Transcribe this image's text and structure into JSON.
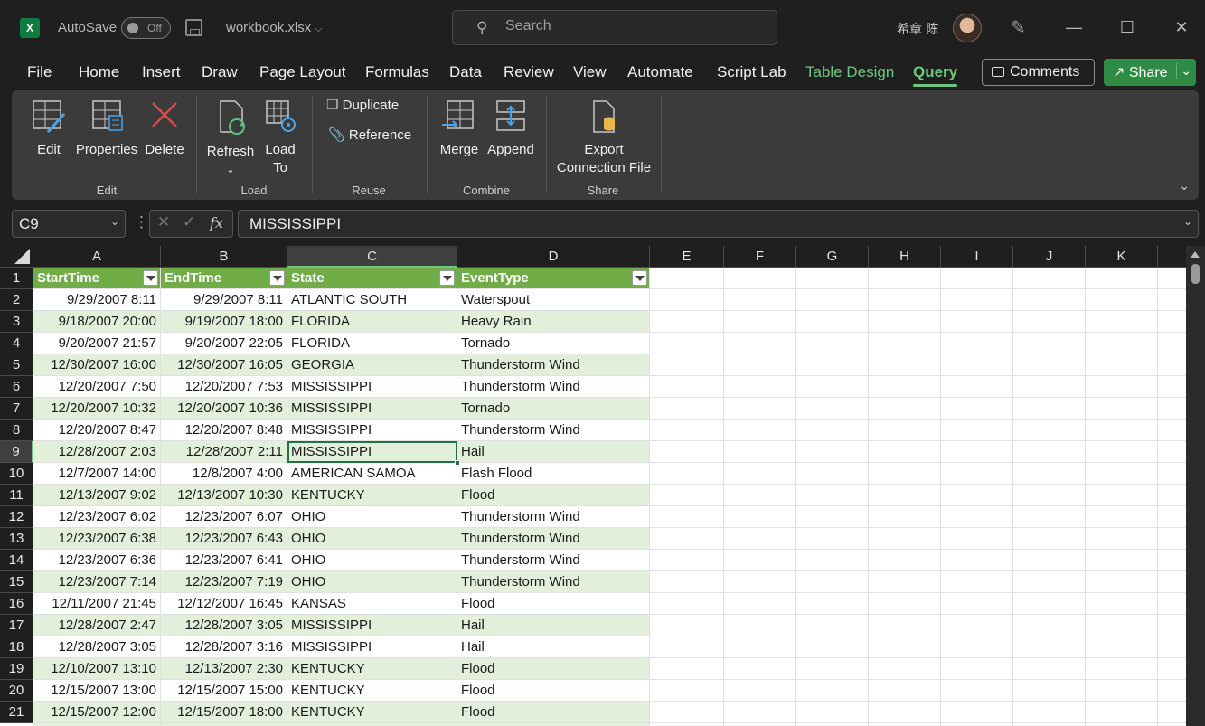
{
  "titlebar": {
    "app_icon": "X",
    "autosave_label": "AutoSave",
    "autosave_state": "Off",
    "filename": "workbook.xlsx",
    "search_placeholder": "Search",
    "user_name": "希章 陈",
    "minimize": "—",
    "maximize": "☐",
    "close": "✕"
  },
  "menu": {
    "tabs": [
      "File",
      "Home",
      "Insert",
      "Draw",
      "Page Layout",
      "Formulas",
      "Data",
      "Review",
      "View",
      "Automate",
      "Script Lab",
      "Table Design",
      "Query"
    ],
    "comments_label": "Comments",
    "share_label": "Share"
  },
  "ribbon": {
    "edit": "Edit",
    "properties": "Properties",
    "delete": "Delete",
    "refresh": "Refresh",
    "load_to_line1": "Load",
    "load_to_line2": "To",
    "duplicate": "Duplicate",
    "reference": "Reference",
    "merge": "Merge",
    "append": "Append",
    "export_line1": "Export",
    "export_line2": "Connection File",
    "groups": [
      "Edit",
      "Load",
      "Reuse",
      "Combine",
      "Share"
    ]
  },
  "formula_bar": {
    "name_box": "C9",
    "cancel_icon": "✕",
    "enter_icon": "✓",
    "fx": "fx",
    "value": "MISSISSIPPI"
  },
  "sheet": {
    "column_letters": [
      "A",
      "B",
      "C",
      "D",
      "E",
      "F",
      "G",
      "H",
      "I",
      "J",
      "K"
    ],
    "selected_column": "C",
    "selected_row": 9,
    "table_headers": [
      "StartTime",
      "EndTime",
      "State",
      "EventType"
    ],
    "rows": [
      [
        "9/29/2007 8:11",
        "9/29/2007 8:11",
        "ATLANTIC SOUTH",
        "Waterspout"
      ],
      [
        "9/18/2007 20:00",
        "9/19/2007 18:00",
        "FLORIDA",
        "Heavy Rain"
      ],
      [
        "9/20/2007 21:57",
        "9/20/2007 22:05",
        "FLORIDA",
        "Tornado"
      ],
      [
        "12/30/2007 16:00",
        "12/30/2007 16:05",
        "GEORGIA",
        "Thunderstorm Wind"
      ],
      [
        "12/20/2007 7:50",
        "12/20/2007 7:53",
        "MISSISSIPPI",
        "Thunderstorm Wind"
      ],
      [
        "12/20/2007 10:32",
        "12/20/2007 10:36",
        "MISSISSIPPI",
        "Tornado"
      ],
      [
        "12/20/2007 8:47",
        "12/20/2007 8:48",
        "MISSISSIPPI",
        "Thunderstorm Wind"
      ],
      [
        "12/28/2007 2:03",
        "12/28/2007 2:11",
        "MISSISSIPPI",
        "Hail"
      ],
      [
        "12/7/2007 14:00",
        "12/8/2007 4:00",
        "AMERICAN SAMOA",
        "Flash Flood"
      ],
      [
        "12/13/2007 9:02",
        "12/13/2007 10:30",
        "KENTUCKY",
        "Flood"
      ],
      [
        "12/23/2007 6:02",
        "12/23/2007 6:07",
        "OHIO",
        "Thunderstorm Wind"
      ],
      [
        "12/23/2007 6:38",
        "12/23/2007 6:43",
        "OHIO",
        "Thunderstorm Wind"
      ],
      [
        "12/23/2007 6:36",
        "12/23/2007 6:41",
        "OHIO",
        "Thunderstorm Wind"
      ],
      [
        "12/23/2007 7:14",
        "12/23/2007 7:19",
        "OHIO",
        "Thunderstorm Wind"
      ],
      [
        "12/11/2007 21:45",
        "12/12/2007 16:45",
        "KANSAS",
        "Flood"
      ],
      [
        "12/28/2007 2:47",
        "12/28/2007 3:05",
        "MISSISSIPPI",
        "Hail"
      ],
      [
        "12/28/2007 3:05",
        "12/28/2007 3:16",
        "MISSISSIPPI",
        "Hail"
      ],
      [
        "12/10/2007 13:10",
        "12/13/2007 2:30",
        "KENTUCKY",
        "Flood"
      ],
      [
        "12/15/2007 13:00",
        "12/15/2007 15:00",
        "KENTUCKY",
        "Flood"
      ],
      [
        "12/15/2007 12:00",
        "12/15/2007 18:00",
        "KENTUCKY",
        "Flood"
      ]
    ]
  },
  "colors": {
    "accent": "#6dc87b",
    "table_header": "#70ad47",
    "table_band": "#e2efda",
    "selection": "#217346",
    "share_button": "#2f8c47"
  }
}
